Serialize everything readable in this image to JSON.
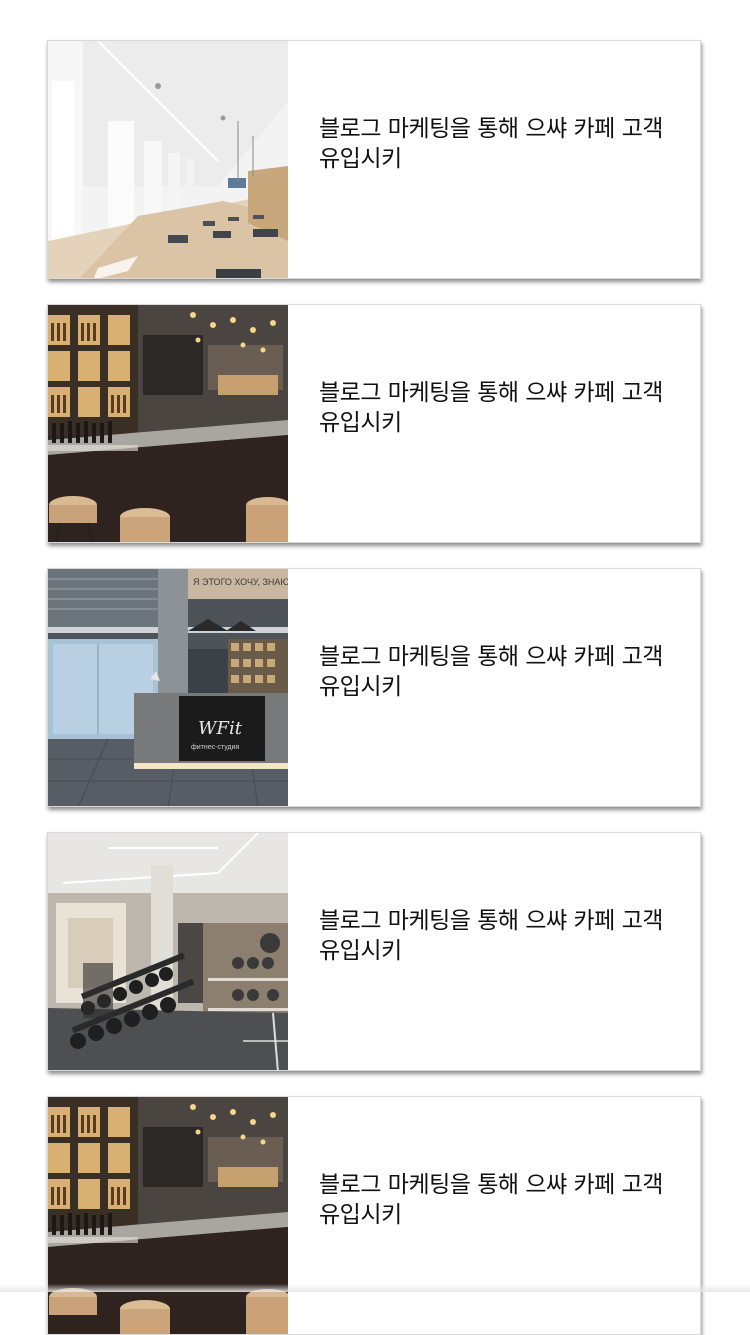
{
  "cards": [
    {
      "title": "블로그 마케팅을 통해 으쌰 카페 고객 유입시키",
      "image": "bright-studio-corridor"
    },
    {
      "title": "블로그 마케팅을 통해 으쌰 카페 고객 유입시키",
      "image": "bar-counter-with-stools"
    },
    {
      "title": "블로그 마케팅을 통해 으쌰 카페 고객 유입시키",
      "image": "fitness-studio-reception",
      "image_text": {
        "brand": "WFit",
        "subtitle": "фитнес-студия",
        "banner": "Я ЭТОГО ХОЧУ, ЗНАЮ"
      }
    },
    {
      "title": "블로그 마케팅을 통해 으쌰 카페 고객 유입시키",
      "image": "gym-dumbbell-rack"
    },
    {
      "title": "블로그 마케팅을 통해 으쌰 카페 고객 유입시키",
      "image": "bar-counter-with-stools"
    }
  ],
  "colors": {
    "card_border": "#d9d9d9",
    "text": "#111111",
    "background": "#ffffff"
  }
}
